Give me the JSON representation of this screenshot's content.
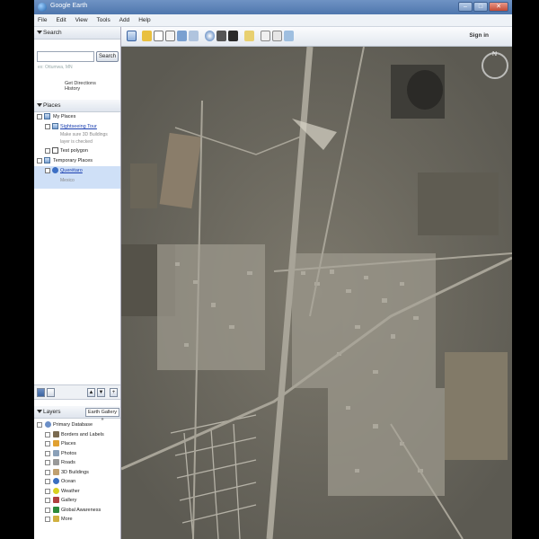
{
  "window": {
    "title": "Google Earth",
    "buttons": {
      "minimize": "–",
      "maximize": "□",
      "close": "✕"
    }
  },
  "menu": [
    "File",
    "Edit",
    "View",
    "Tools",
    "Add",
    "Help"
  ],
  "search": {
    "header": "Search",
    "placeholder": "",
    "button": "Search",
    "hint": "ex: Ottumwa, MN",
    "links": [
      "Get Directions",
      "History"
    ]
  },
  "places": {
    "header": "Places",
    "items": [
      {
        "label": "My Places",
        "level": 0
      },
      {
        "label": "Sightseeing Tour",
        "level": 1,
        "link": true
      },
      {
        "label": "Make sure 3D Buildings",
        "level": 2,
        "sub": true
      },
      {
        "label": "layer is checked",
        "level": 2,
        "sub": true
      },
      {
        "label": "Test polygon",
        "level": 1
      },
      {
        "label": "Temporary Places",
        "level": 0
      },
      {
        "label": "Querétaro",
        "level": 1,
        "link": true,
        "selected": true
      },
      {
        "label": "Mexico",
        "level": 2,
        "sub": true,
        "selected": true
      }
    ]
  },
  "layers": {
    "header": "Layers",
    "gallery": "Earth Gallery »",
    "items": [
      {
        "label": "Primary Database",
        "root": true,
        "icon": "globe-icon",
        "color": "#6b8fc7"
      },
      {
        "label": "Borders and Labels",
        "icon": "flag-icon",
        "color": "#7a6a50"
      },
      {
        "label": "Places",
        "icon": "places-icon",
        "color": "#e0a030"
      },
      {
        "label": "Photos",
        "icon": "photo-icon",
        "color": "#8aa0b8"
      },
      {
        "label": "Roads",
        "icon": "road-icon",
        "color": "#999999"
      },
      {
        "label": "3D Buildings",
        "icon": "building-icon",
        "color": "#c0a070"
      },
      {
        "label": "Ocean",
        "icon": "ocean-icon",
        "color": "#3a6fc0"
      },
      {
        "label": "Weather",
        "icon": "weather-icon",
        "color": "#d8d020"
      },
      {
        "label": "Gallery",
        "icon": "gallery-icon",
        "color": "#b04040"
      },
      {
        "label": "Global Awareness",
        "icon": "awareness-icon",
        "color": "#2d8a3a"
      },
      {
        "label": "More",
        "icon": "more-icon",
        "color": "#d0b040"
      }
    ]
  },
  "toolbar": {
    "signin": "Sign in",
    "tools": [
      "hide-sidebar-icon",
      "placemark-icon",
      "polygon-icon",
      "path-icon",
      "overlay-icon",
      "tour-icon",
      "historical-imagery-icon",
      "sun-icon",
      "planets-icon",
      "ruler-icon",
      "email-icon",
      "print-icon",
      "view-in-maps-icon"
    ]
  },
  "map": {
    "compass_label": "N"
  }
}
